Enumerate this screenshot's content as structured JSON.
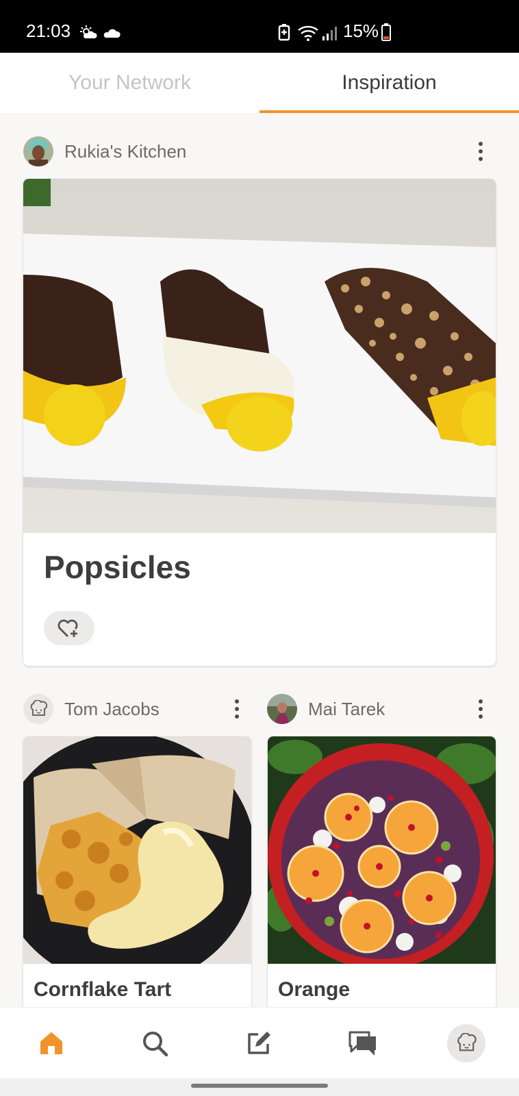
{
  "status_bar": {
    "time": "21:03",
    "battery": "15%",
    "icons": [
      "sun-cloud-icon",
      "cloud-icon",
      "battery-saver-icon",
      "wifi-icon",
      "signal-icon",
      "battery-icon"
    ]
  },
  "tabs": [
    {
      "label": "Your Network",
      "active": false
    },
    {
      "label": "Inspiration",
      "active": true
    }
  ],
  "feed": {
    "featured": {
      "author": "Rukia's Kitchen",
      "title": "Popsicles"
    },
    "grid": [
      {
        "author": "Tom Jacobs",
        "title": "Cornflake Tart"
      },
      {
        "author": "Mai Tarek",
        "title": "Orange"
      }
    ]
  },
  "bottom_nav": [
    {
      "name": "home",
      "icon": "home-icon",
      "active": true
    },
    {
      "name": "search",
      "icon": "search-icon",
      "active": false
    },
    {
      "name": "write",
      "icon": "edit-icon",
      "active": false
    },
    {
      "name": "chat",
      "icon": "chat-icon",
      "active": false
    },
    {
      "name": "profile",
      "icon": "chef-avatar-icon",
      "active": false
    }
  ],
  "colors": {
    "accent": "#f2922a",
    "text_primary": "#3d3d3d",
    "text_secondary": "#6c6b69",
    "inactive_tab": "#c6c4c2",
    "background": "#f8f7f5"
  }
}
